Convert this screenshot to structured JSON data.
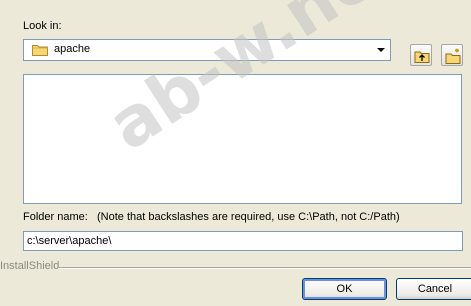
{
  "look_in": {
    "label": "Look in:",
    "value": "apache"
  },
  "toolbar": {
    "up_icon": "up-folder-icon",
    "new_folder_icon": "new-folder-icon"
  },
  "folder_name": {
    "label": "Folder name:",
    "note": "(Note that backslashes are required, use C:\\Path, not C:/Path)",
    "value": "c:\\server\\apache\\"
  },
  "footer": {
    "brand": "InstallShield",
    "ok_label": "OK",
    "cancel_label": "Cancel"
  },
  "watermark": "ab-w.net",
  "colors": {
    "window_bg": "#ece9d8",
    "field_border": "#7f9db9",
    "button_border": "#003c74"
  }
}
